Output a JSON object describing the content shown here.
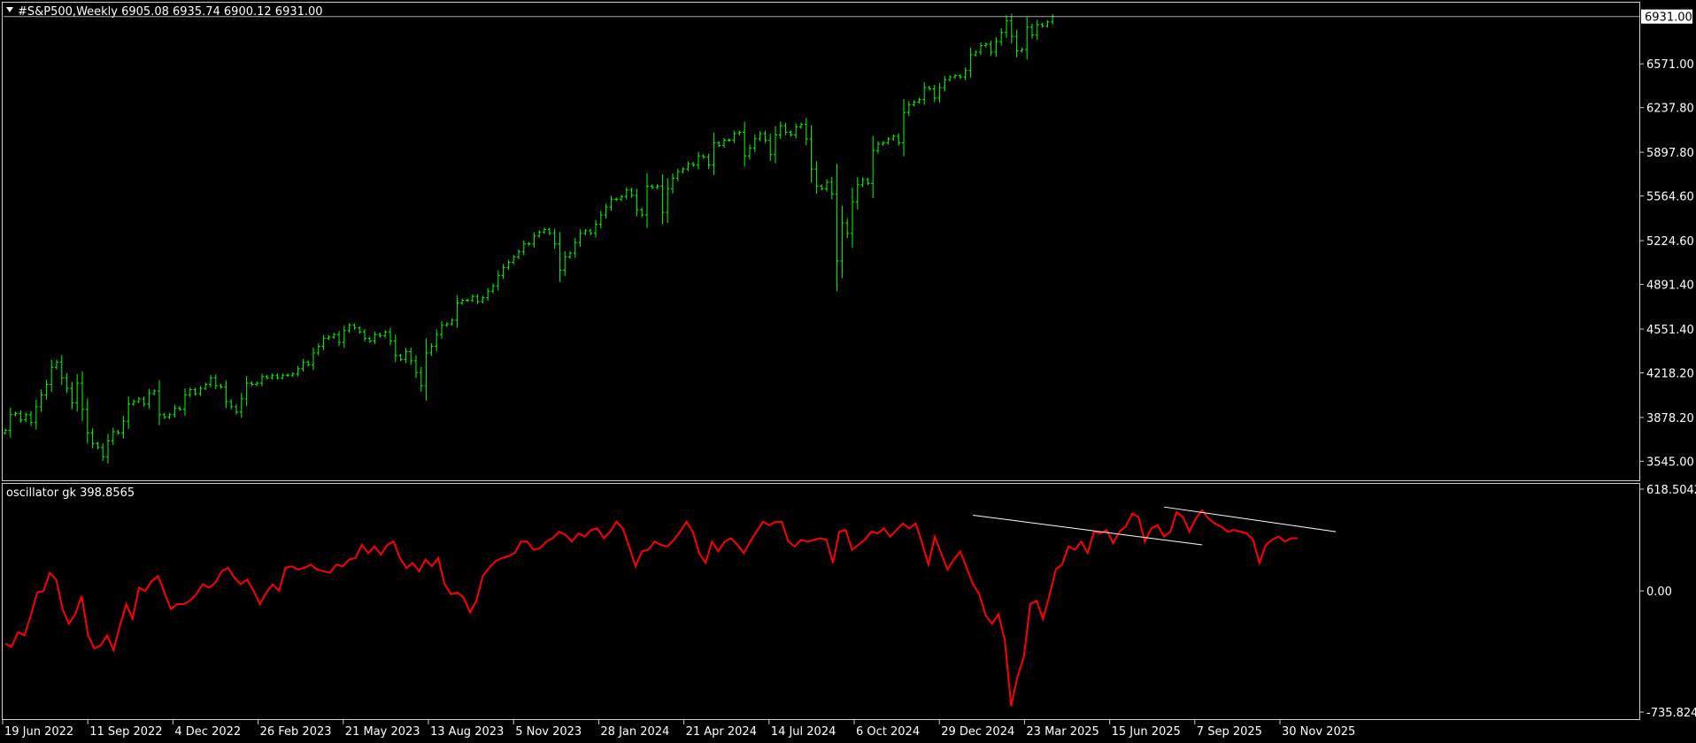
{
  "chart_data": [
    {
      "type": "ohlc",
      "symbol": "#S&P500",
      "timeframe": "Weekly",
      "header": "#S&P500,Weekly  6905.08 6935.74 6900.12 6931.00",
      "last_ohlc": {
        "open": 6905.08,
        "high": 6935.74,
        "low": 6900.12,
        "close": 6931.0
      },
      "current_price_label": "6931.00",
      "bar_color": "#00ff00",
      "ylim": [
        3400,
        7030
      ],
      "y_ticks": [
        {
          "value": 6571.0,
          "label": "6571.00"
        },
        {
          "value": 6237.8,
          "label": "6237.80"
        },
        {
          "value": 5897.8,
          "label": "5897.80"
        },
        {
          "value": 5564.6,
          "label": "5564.60"
        },
        {
          "value": 5224.6,
          "label": "5224.60"
        },
        {
          "value": 4891.4,
          "label": "4891.40"
        },
        {
          "value": 4551.4,
          "label": "4551.40"
        },
        {
          "value": 4218.2,
          "label": "4218.20"
        },
        {
          "value": 3878.2,
          "label": "3878.20"
        },
        {
          "value": 3545.0,
          "label": "3545.00"
        }
      ],
      "weekly_close_path": [
        [
          0,
          3780
        ],
        [
          1,
          3900
        ],
        [
          2,
          3910
        ],
        [
          3,
          3860
        ],
        [
          4,
          3900
        ],
        [
          5,
          3840
        ],
        [
          6,
          3960
        ],
        [
          7,
          4050
        ],
        [
          8,
          4130
        ],
        [
          9,
          4260
        ],
        [
          10,
          4300
        ],
        [
          11,
          4180
        ],
        [
          12,
          4100
        ],
        [
          13,
          3990
        ],
        [
          14,
          4140
        ],
        [
          15,
          3940
        ],
        [
          16,
          3760
        ],
        [
          17,
          3680
        ],
        [
          18,
          3650
        ],
        [
          19,
          3580
        ],
        [
          20,
          3700
        ],
        [
          21,
          3770
        ],
        [
          22,
          3760
        ],
        [
          23,
          3850
        ],
        [
          24,
          3980
        ],
        [
          25,
          4000
        ],
        [
          26,
          4020
        ],
        [
          27,
          3980
        ],
        [
          28,
          4060
        ],
        [
          29,
          4080
        ],
        [
          30,
          3900
        ],
        [
          31,
          3880
        ],
        [
          32,
          3900
        ],
        [
          33,
          3950
        ],
        [
          34,
          3940
        ],
        [
          35,
          4050
        ],
        [
          36,
          4090
        ],
        [
          37,
          4060
        ],
        [
          38,
          4100
        ],
        [
          39,
          4130
        ],
        [
          40,
          4180
        ],
        [
          41,
          4120
        ],
        [
          42,
          4110
        ],
        [
          43,
          4000
        ],
        [
          44,
          3960
        ],
        [
          45,
          3920
        ],
        [
          46,
          4020
        ],
        [
          47,
          4140
        ],
        [
          48,
          4130
        ],
        [
          49,
          4140
        ],
        [
          50,
          4190
        ],
        [
          51,
          4180
        ],
        [
          52,
          4200
        ],
        [
          53,
          4180
        ],
        [
          54,
          4200
        ],
        [
          55,
          4200
        ],
        [
          56,
          4210
        ],
        [
          57,
          4250
        ],
        [
          58,
          4300
        ],
        [
          59,
          4280
        ],
        [
          60,
          4370
        ],
        [
          61,
          4420
        ],
        [
          62,
          4480
        ],
        [
          63,
          4490
        ],
        [
          64,
          4510
        ],
        [
          65,
          4450
        ],
        [
          66,
          4540
        ],
        [
          67,
          4580
        ],
        [
          68,
          4560
        ],
        [
          69,
          4530
        ],
        [
          70,
          4480
        ],
        [
          71,
          4460
        ],
        [
          72,
          4510
        ],
        [
          73,
          4500
        ],
        [
          74,
          4530
        ],
        [
          75,
          4460
        ],
        [
          76,
          4350
        ],
        [
          77,
          4320
        ],
        [
          78,
          4380
        ],
        [
          79,
          4310
        ],
        [
          80,
          4220
        ],
        [
          81,
          4120
        ],
        [
          82,
          4370
        ],
        [
          83,
          4420
        ],
        [
          84,
          4510
        ],
        [
          85,
          4580
        ],
        [
          86,
          4590
        ],
        [
          87,
          4620
        ],
        [
          88,
          4750
        ],
        [
          89,
          4770
        ],
        [
          90,
          4770
        ],
        [
          91,
          4800
        ],
        [
          92,
          4760
        ],
        [
          93,
          4790
        ],
        [
          94,
          4840
        ],
        [
          95,
          4880
        ],
        [
          96,
          4960
        ],
        [
          97,
          5020
        ],
        [
          98,
          5060
        ],
        [
          99,
          5100
        ],
        [
          100,
          5140
        ],
        [
          101,
          5200
        ],
        [
          102,
          5200
        ],
        [
          103,
          5260
        ],
        [
          104,
          5290
        ],
        [
          105,
          5310
        ],
        [
          106,
          5280
        ],
        [
          107,
          5200
        ],
        [
          108,
          5000
        ],
        [
          109,
          5100
        ],
        [
          110,
          5130
        ],
        [
          111,
          5210
        ],
        [
          112,
          5280
        ],
        [
          113,
          5300
        ],
        [
          114,
          5280
        ],
        [
          115,
          5350
        ],
        [
          116,
          5420
        ],
        [
          117,
          5480
        ],
        [
          118,
          5540
        ],
        [
          119,
          5540
        ],
        [
          120,
          5560
        ],
        [
          121,
          5610
        ],
        [
          122,
          5570
        ],
        [
          123,
          5460
        ],
        [
          124,
          5420
        ],
        [
          125,
          5640
        ],
        [
          126,
          5630
        ],
        [
          127,
          5640
        ],
        [
          128,
          5440
        ],
        [
          129,
          5620
        ],
        [
          130,
          5700
        ],
        [
          131,
          5750
        ],
        [
          132,
          5770
        ],
        [
          133,
          5810
        ],
        [
          134,
          5800
        ],
        [
          135,
          5870
        ],
        [
          136,
          5860
        ],
        [
          137,
          5800
        ],
        [
          138,
          5970
        ],
        [
          139,
          5950
        ],
        [
          140,
          5990
        ],
        [
          141,
          5990
        ],
        [
          142,
          6040
        ],
        [
          143,
          6050
        ],
        [
          144,
          5870
        ],
        [
          145,
          5930
        ],
        [
          146,
          6000
        ],
        [
          147,
          6040
        ],
        [
          148,
          5990
        ],
        [
          149,
          5880
        ],
        [
          150,
          6030
        ],
        [
          151,
          6100
        ],
        [
          152,
          6050
        ],
        [
          153,
          6030
        ],
        [
          154,
          6090
        ],
        [
          155,
          6110
        ],
        [
          156,
          6000
        ],
        [
          157,
          5770
        ],
        [
          158,
          5640
        ],
        [
          159,
          5620
        ],
        [
          160,
          5670
        ],
        [
          161,
          5580
        ],
        [
          162,
          5070
        ],
        [
          163,
          5360
        ],
        [
          164,
          5280
        ],
        [
          165,
          5520
        ],
        [
          166,
          5650
        ],
        [
          167,
          5690
        ],
        [
          168,
          5660
        ],
        [
          169,
          5910
        ],
        [
          170,
          5960
        ],
        [
          171,
          5970
        ],
        [
          172,
          6000
        ],
        [
          173,
          6020
        ],
        [
          174,
          5970
        ],
        [
          175,
          6200
        ],
        [
          176,
          6260
        ],
        [
          177,
          6280
        ],
        [
          178,
          6300
        ],
        [
          179,
          6390
        ],
        [
          180,
          6380
        ],
        [
          181,
          6310
        ],
        [
          182,
          6390
        ],
        [
          183,
          6450
        ],
        [
          184,
          6470
        ],
        [
          185,
          6480
        ],
        [
          186,
          6470
        ],
        [
          187,
          6520
        ],
        [
          188,
          6640
        ],
        [
          189,
          6660
        ],
        [
          190,
          6710
        ],
        [
          191,
          6720
        ],
        [
          192,
          6660
        ],
        [
          193,
          6740
        ],
        [
          194,
          6810
        ],
        [
          195,
          6900
        ],
        [
          196,
          6780
        ],
        [
          197,
          6670
        ],
        [
          198,
          6680
        ],
        [
          199,
          6850
        ],
        [
          200,
          6790
        ],
        [
          201,
          6870
        ],
        [
          202,
          6860
        ],
        [
          203,
          6890
        ],
        [
          204,
          6931
        ]
      ],
      "x_tick_labels": [
        "19 Jun 2022",
        "11 Sep 2022",
        "4 Dec 2022",
        "26 Feb 2023",
        "21 May 2023",
        "13 Aug 2023",
        "5 Nov 2023",
        "28 Jan 2024",
        "21 Apr 2024",
        "14 Jul 2024",
        "6 Oct 2024",
        "29 Dec 2024",
        "23 Mar 2025",
        "15 Jun 2025",
        "7 Sep 2025",
        "30 Nov 2025"
      ]
    },
    {
      "type": "line",
      "title": "oscillator gk 398.8565",
      "line_color": "#ff0000",
      "trendline_color": "#ffffff",
      "ylim": [
        -735.8245,
        618.5042
      ],
      "y_ticks": [
        {
          "value": 618.5042,
          "label": "618.5042"
        },
        {
          "value": 0,
          "label": "0.00"
        },
        {
          "value": -735.8245,
          "label": "-735.8245"
        }
      ],
      "series": [
        {
          "values": [
            -320,
            -340,
            -250,
            -270,
            -150,
            -10,
            0,
            110,
            70,
            -110,
            -200,
            -140,
            -30,
            -270,
            -350,
            -330,
            -270,
            -360,
            -210,
            -80,
            -170,
            20,
            0,
            60,
            90,
            -10,
            -110,
            -80,
            -80,
            -60,
            -20,
            40,
            20,
            50,
            120,
            140,
            80,
            40,
            70,
            0,
            -80,
            -10,
            40,
            0,
            140,
            150,
            130,
            140,
            160,
            130,
            120,
            110,
            160,
            150,
            190,
            200,
            280,
            230,
            270,
            220,
            280,
            300,
            200,
            140,
            170,
            120,
            190,
            150,
            200,
            40,
            -20,
            -10,
            -40,
            -130,
            -60,
            90,
            140,
            180,
            200,
            210,
            230,
            300,
            300,
            250,
            260,
            300,
            320,
            360,
            340,
            300,
            350,
            330,
            370,
            380,
            320,
            360,
            420,
            380,
            270,
            150,
            240,
            250,
            300,
            280,
            270,
            310,
            360,
            420,
            360,
            230,
            170,
            300,
            240,
            300,
            320,
            280,
            230,
            300,
            360,
            420,
            400,
            420,
            420,
            300,
            270,
            310,
            300,
            310,
            320,
            310,
            170,
            360,
            370,
            250,
            280,
            310,
            360,
            350,
            380,
            330,
            370,
            410,
            380,
            410,
            290,
            160,
            330,
            230,
            130,
            190,
            240,
            140,
            40,
            -20,
            -150,
            -200,
            -140,
            -300,
            -700,
            -520,
            -400,
            -80,
            -60,
            -170,
            -30,
            130,
            160,
            270,
            250,
            300,
            230,
            360,
            350,
            370,
            290,
            360,
            390,
            470,
            450,
            300,
            380,
            400,
            330,
            360,
            480,
            450,
            360,
            440,
            490,
            440,
            410,
            390,
            360,
            370,
            360,
            350,
            310,
            170,
            280,
            310,
            330,
            300,
            320,
            320
          ]
        }
      ],
      "annotations": [
        {
          "type": "trendline",
          "from": {
            "x": 152,
            "y": 460
          },
          "to": {
            "x": 188,
            "y": 280
          }
        },
        {
          "type": "trendline",
          "from": {
            "x": 182,
            "y": 510
          },
          "to": {
            "x": 209,
            "y": 360
          }
        }
      ]
    }
  ]
}
